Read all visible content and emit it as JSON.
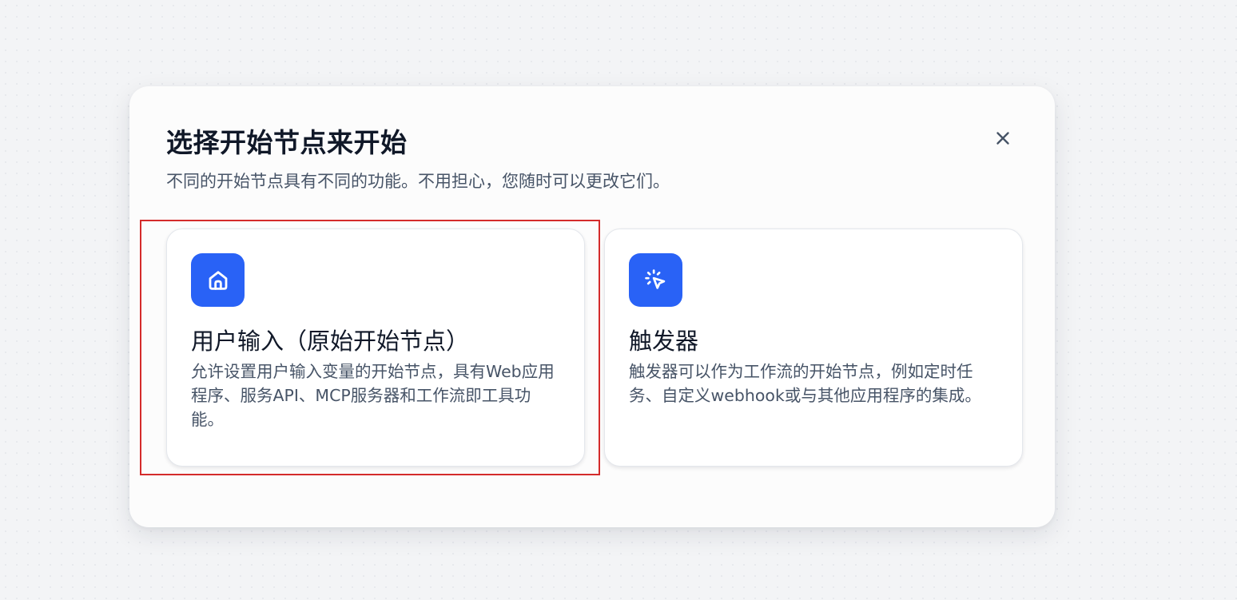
{
  "dialog": {
    "title": "选择开始节点来开始",
    "subtitle": "不同的开始节点具有不同的功能。不用担心，您随时可以更改它们。",
    "close_icon": "close-icon"
  },
  "options": [
    {
      "icon": "home-icon",
      "title": "用户输入（原始开始节点）",
      "description": "允许设置用户输入变量的开始节点，具有Web应用程序、服务API、MCP服务器和工作流即工具功能。"
    },
    {
      "icon": "cursor-click-icon",
      "title": "触发器",
      "description": "触发器可以作为工作流的开始节点，例如定时任务、自定义webhook或与其他应用程序的集成。"
    }
  ],
  "colors": {
    "accent": "#2962f6",
    "highlight": "#d42b2b",
    "title": "#101828",
    "muted": "#475467"
  }
}
